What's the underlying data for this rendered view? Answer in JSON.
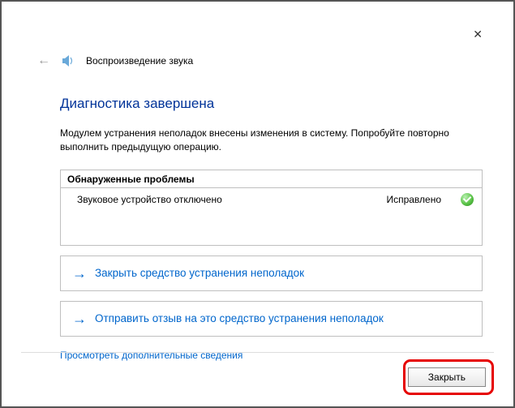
{
  "window": {
    "title": "Воспроизведение звука"
  },
  "heading": "Диагностика завершена",
  "description": "Модулем устранения неполадок внесены изменения в систему. Попробуйте повторно выполнить предыдущую операцию.",
  "problems": {
    "header": "Обнаруженные проблемы",
    "item": {
      "label": "Звуковое устройство отключено",
      "status": "Исправлено"
    }
  },
  "actions": {
    "close_tool": "Закрыть средство устранения неполадок",
    "send_feedback": "Отправить отзыв на это средство устранения неполадок"
  },
  "more_info": "Просмотреть дополнительные сведения",
  "buttons": {
    "close": "Закрыть"
  }
}
